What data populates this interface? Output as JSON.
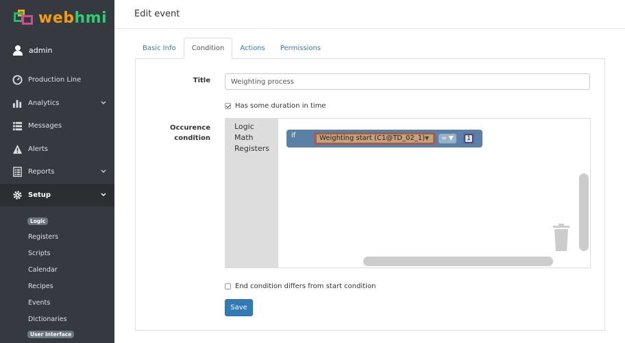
{
  "brand": {
    "name_w": "web",
    "name_h": "hmi"
  },
  "user": {
    "name": "admin"
  },
  "nav": {
    "items": [
      {
        "label": "Production Line",
        "icon": "dashboard-icon"
      },
      {
        "label": "Analytics",
        "icon": "bar-chart-icon"
      },
      {
        "label": "Messages",
        "icon": "list-icon"
      },
      {
        "label": "Alerts",
        "icon": "warning-icon"
      },
      {
        "label": "Reports",
        "icon": "report-icon"
      },
      {
        "label": "Setup",
        "icon": "gear-icon"
      }
    ],
    "sub": {
      "logic_badge": "Logic",
      "items": [
        "Registers",
        "Scripts",
        "Calendar",
        "Recipes",
        "Events",
        "Dictionaries"
      ],
      "ui_badge": "User Interface"
    }
  },
  "page": {
    "title": "Edit event"
  },
  "tabs": [
    "Basic Info",
    "Condition",
    "Actions",
    "Permissions"
  ],
  "form": {
    "title_label": "Title",
    "title_value": "Weighting process",
    "duration_label": "Has some duration in time",
    "condition_label_1": "Occurence",
    "condition_label_2": "condition",
    "end_condition_label": "End condition differs from start condition",
    "save_label": "Save"
  },
  "blockly": {
    "toolbox": [
      "Logic",
      "Math",
      "Registers"
    ],
    "if_label": "if",
    "register": "Weighting start (C1@TD_02_1)",
    "dropdown_arrow": "▼",
    "operator": "= ▼",
    "number": "1"
  },
  "colors": {
    "sidebar": "#343a40",
    "primary": "#337ab7",
    "logic_block": "#5b80a5"
  }
}
